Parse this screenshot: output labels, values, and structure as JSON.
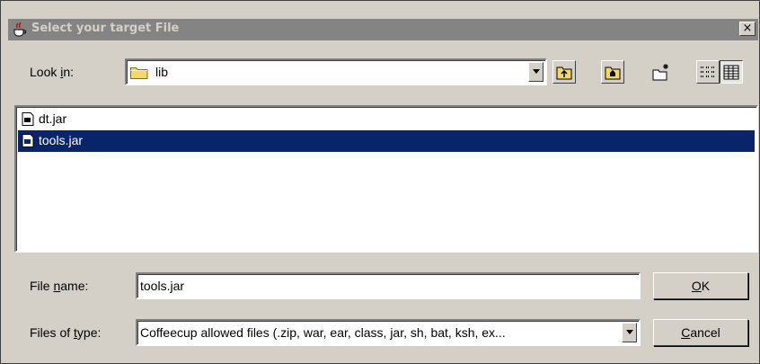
{
  "window": {
    "title": "Select your target File",
    "close_label": "×"
  },
  "look_in": {
    "label_pre": "Look ",
    "label_mn": "i",
    "label_post": "n:",
    "value": "lib"
  },
  "toolbar": {
    "buttons": [
      "up-one-level",
      "home",
      "new-folder",
      "list-view",
      "details-view"
    ]
  },
  "files": [
    {
      "name": "dt.jar",
      "selected": false
    },
    {
      "name": "tools.jar",
      "selected": true
    }
  ],
  "file_name": {
    "label_pre": "File ",
    "label_mn": "n",
    "label_post": "ame:",
    "value": "tools.jar"
  },
  "file_type": {
    "label_pre": "Files of ",
    "label_mn": "t",
    "label_post": "ype:",
    "value": "Coffeecup allowed files (.zip, war, ear, class, jar, sh, bat, ksh, ex..."
  },
  "buttons": {
    "ok_mn": "O",
    "ok_rest": "K",
    "cancel_mn": "C",
    "cancel_rest": "ancel"
  },
  "colors": {
    "face": "#d4d0c8",
    "title_inactive": "#848484",
    "selection": "#0a246a"
  }
}
